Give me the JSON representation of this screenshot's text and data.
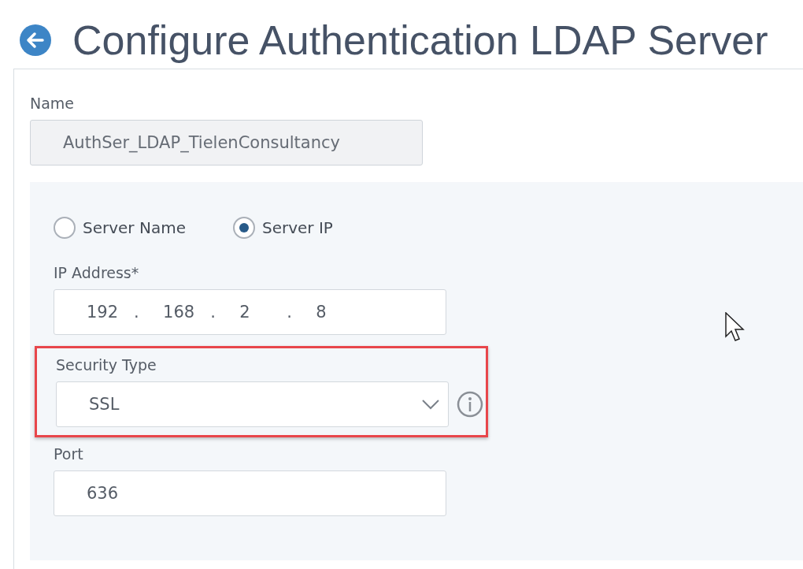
{
  "page": {
    "title": "Configure Authentication LDAP Server"
  },
  "name_field": {
    "label": "Name",
    "value": "AuthSer_LDAP_TielenConsultancy",
    "disabled": true
  },
  "server_options": [
    {
      "label": "Server Name",
      "selected": false
    },
    {
      "label": "Server IP",
      "selected": true
    }
  ],
  "ip_address": {
    "label": "IP Address*",
    "octets": [
      "192",
      "168",
      "2",
      "8"
    ],
    "separator": "."
  },
  "security_type": {
    "label": "Security Type",
    "value": "SSL",
    "highlighted": true
  },
  "port": {
    "label": "Port",
    "value": "636"
  }
}
